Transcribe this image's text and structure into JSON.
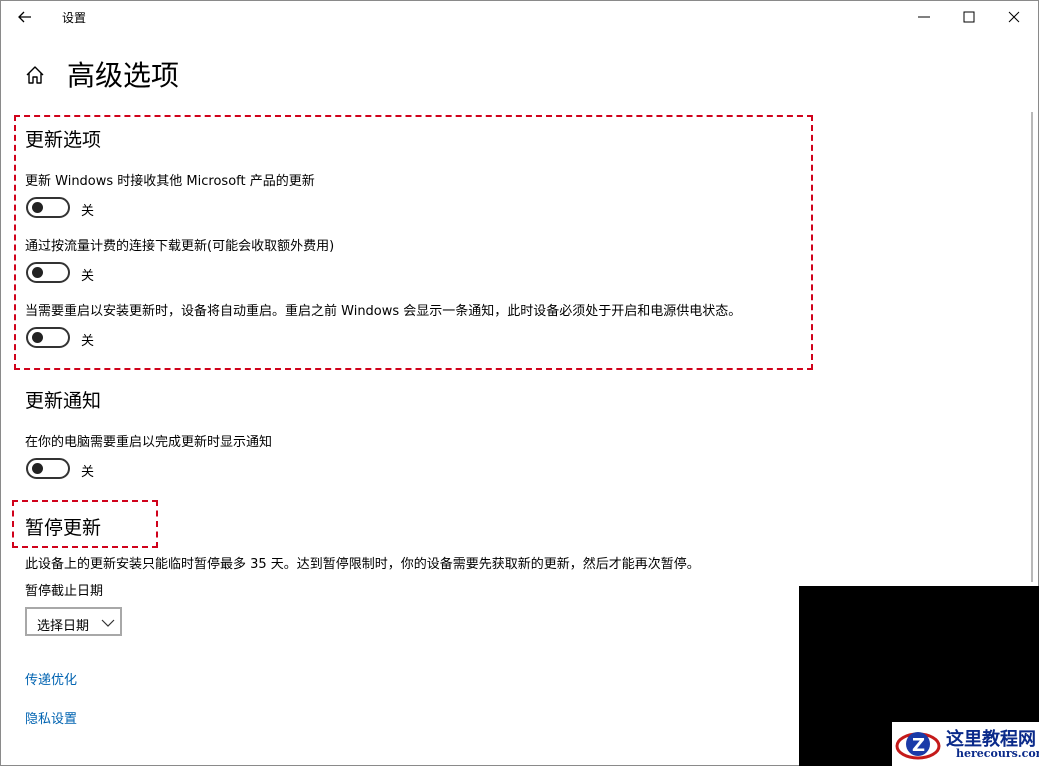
{
  "window": {
    "app_title": "设置"
  },
  "page": {
    "title": "高级选项"
  },
  "update_options": {
    "heading": "更新选项",
    "items": [
      {
        "label": "更新 Windows 时接收其他 Microsoft 产品的更新",
        "state": "关",
        "on": false
      },
      {
        "label": "通过按流量计费的连接下载更新(可能会收取额外费用)",
        "state": "关",
        "on": false
      },
      {
        "label": "当需要重启以安装更新时，设备将自动重启。重启之前 Windows 会显示一条通知，此时设备必须处于开启和电源供电状态。",
        "state": "关",
        "on": false
      }
    ]
  },
  "update_notify": {
    "heading": "更新通知",
    "items": [
      {
        "label": "在你的电脑需要重启以完成更新时显示通知",
        "state": "关",
        "on": false
      }
    ]
  },
  "pause_updates": {
    "heading": "暂停更新",
    "description": "此设备上的更新安装只能临时暂停最多 35 天。达到暂停限制时，你的设备需要先获取新的更新，然后才能再次暂停。",
    "date_label": "暂停截止日期",
    "date_select": "选择日期"
  },
  "links": {
    "delivery_optimization": "传递优化",
    "privacy_settings": "隐私设置"
  },
  "watermark": {
    "name": "这里教程网",
    "url": "herecours.com"
  },
  "colors": {
    "link": "#0063b1",
    "highlight": "#d0021b"
  }
}
